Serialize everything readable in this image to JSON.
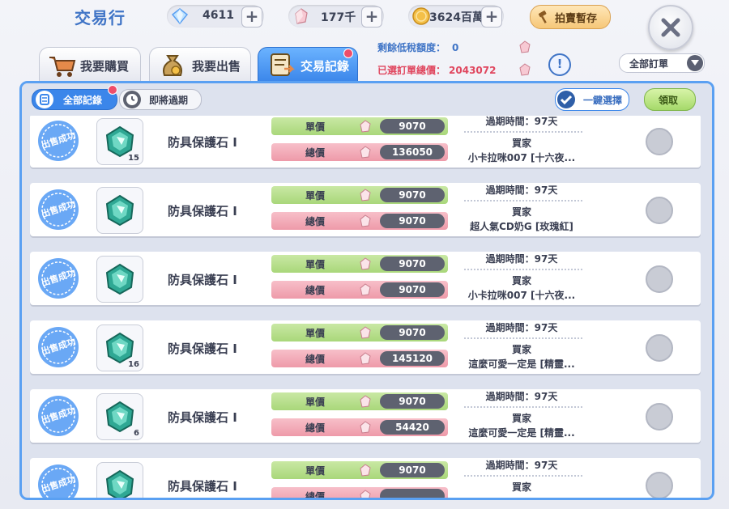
{
  "header": {
    "title": "交易行",
    "diamonds": "4611",
    "crystals": "177千",
    "gold": "3624百萬",
    "auction_label": "拍賣暫存"
  },
  "tabs": [
    {
      "label": "我要購買",
      "active": false
    },
    {
      "label": "我要出售",
      "active": false
    },
    {
      "label": "交易記錄",
      "active": true
    }
  ],
  "summary": {
    "tax_label": "剩餘低稅額度：",
    "tax_value": "0",
    "total_label": "已選訂單總價：",
    "total_value": "2043072"
  },
  "order_filter": {
    "selected": "全部訂單"
  },
  "filters": {
    "all_records": "全部記錄",
    "expiring": "即將過期",
    "select_all": "一鍵選擇",
    "claim": "領取"
  },
  "labels": {
    "unit_price": "單價",
    "total_price": "總價",
    "buyer": "買家",
    "stamp": "出售成功"
  },
  "records": [
    {
      "item": "防具保護石 Ⅰ",
      "qty": "15",
      "unit": "9070",
      "total": "136050",
      "expire": "過期時間：97天",
      "buyer": "小卡拉咪007 [十六夜..."
    },
    {
      "item": "防具保護石 Ⅰ",
      "qty": "",
      "unit": "9070",
      "total": "9070",
      "expire": "過期時間：97天",
      "buyer": "超人氣CD奶G [玫瑰紅]"
    },
    {
      "item": "防具保護石 Ⅰ",
      "qty": "",
      "unit": "9070",
      "total": "9070",
      "expire": "過期時間：97天",
      "buyer": "小卡拉咪007 [十六夜..."
    },
    {
      "item": "防具保護石 Ⅰ",
      "qty": "16",
      "unit": "9070",
      "total": "145120",
      "expire": "過期時間：97天",
      "buyer": "這麼可愛一定是 [精靈..."
    },
    {
      "item": "防具保護石 Ⅰ",
      "qty": "6",
      "unit": "9070",
      "total": "54420",
      "expire": "過期時間：97天",
      "buyer": "這麼可愛一定是 [精靈..."
    },
    {
      "item": "防具保護石 Ⅰ",
      "qty": "",
      "unit": "9070",
      "total": "",
      "expire": "過期時間：97天",
      "buyer": ""
    }
  ],
  "colors": {
    "accent_blue": "#3b86ea",
    "unit_bar": "#a9d77a",
    "total_bar": "#ee9aa9",
    "stamp_blue": "#6aa8f5",
    "total_text": "#e0465e"
  }
}
